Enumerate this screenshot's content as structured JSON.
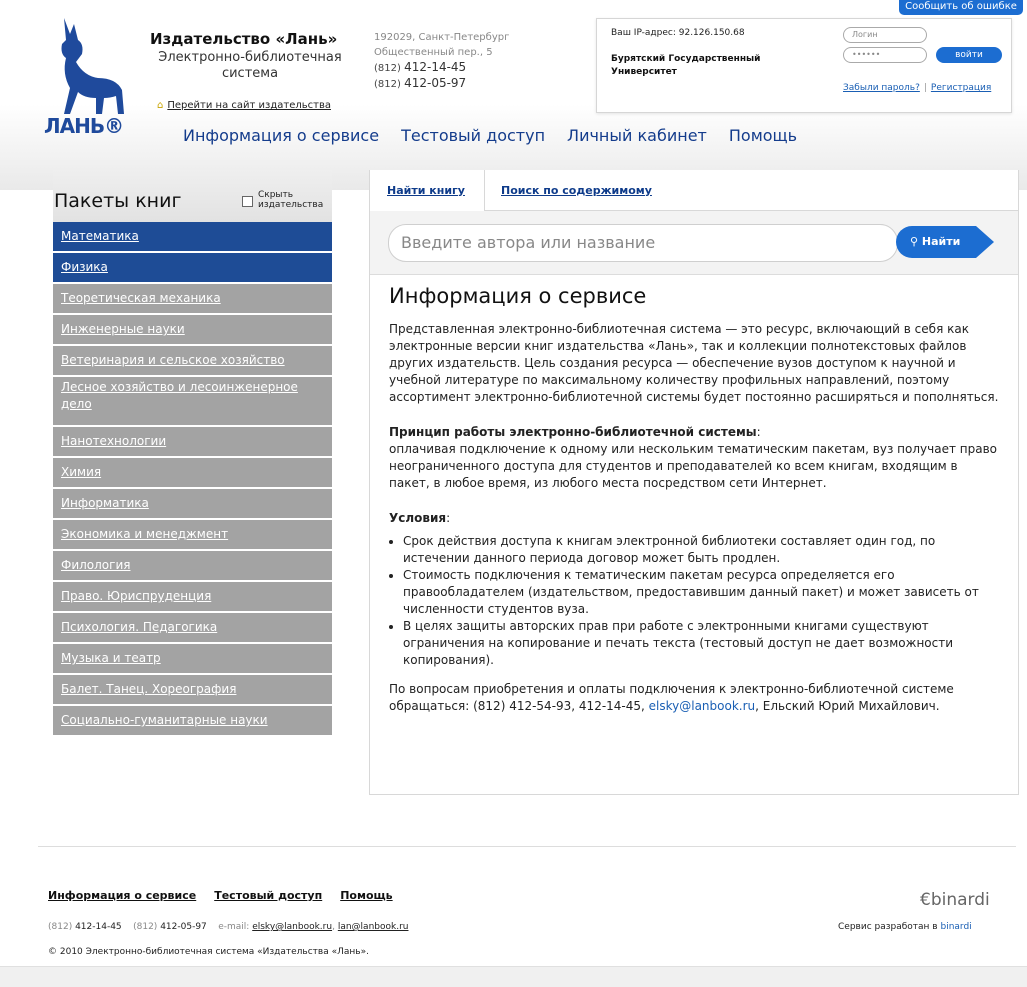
{
  "header": {
    "logo_text": "ЛАНЬ®",
    "brand_title": "Издательство «Лань»",
    "brand_sub": "Электронно-библиотечная система",
    "site_link": "Перейти на сайт издательства",
    "address_line1": "192029, Санкт-Петербург",
    "address_line2": "Общественный пер., 5",
    "phone1_prefix": "(812)",
    "phone1": "412-14-45",
    "phone2_prefix": "(812)",
    "phone2": "412-05-97"
  },
  "login": {
    "report_button": "Сообщить об ошибке",
    "ip_label": "Ваш IP-адрес: 92.126.150.68",
    "organization": "Бурятский Государственный Университет",
    "login_placeholder": "Логин",
    "password_placeholder": "••••••",
    "login_button": "войти",
    "forgot_link": "Забыли пароль?",
    "separator": "|",
    "register_link": "Регистрация"
  },
  "main_nav": [
    "Информация о сервисе",
    "Тестовый доступ",
    "Личный кабинет",
    "Помощь"
  ],
  "sidebar": {
    "title": "Пакеты книг",
    "hide_label": "Скрыть издательства",
    "categories": [
      "Математика",
      "Физика",
      "Теоретическая механика",
      "Инженерные науки",
      "Ветеринария и сельское хозяйство",
      "Лесное хозяйство и лесоинженерное дело",
      "Нанотехнологии",
      "Химия",
      "Информатика",
      "Экономика и менеджмент",
      "Филология",
      "Право. Юриспруденция",
      "Психология. Педагогика",
      "Музыка и театр",
      "Балет. Танец. Хореография",
      "Социально-гуманитарные науки"
    ]
  },
  "tabs": {
    "find_book": "Найти книгу",
    "content_search": "Поиск по содержимому"
  },
  "search": {
    "placeholder": "Введите автора или название",
    "button": "Найти"
  },
  "article": {
    "title": "Информация о сервисе",
    "intro": "Представленная электронно-библиотечная система — это ресурс, включающий в себя как электронные версии книг издательства «Лань», так и коллекции полнотекстовых файлов других издательств. Цель создания ресурса — обеспечение вузов доступом к научной и учебной литературе по максимальному количеству профильных направлений, поэтому ассортимент электронно-библиотечной системы будет постоянно расширяться и пополняться.",
    "principle_heading": "Принцип работы электронно-библиотечной системы",
    "principle_colon": ":",
    "principle_text": "оплачивая подключение к одному или нескольким тематическим пакетам, вуз получает право неограниченного доступа для студентов и преподавателей ко всем книгам, входящим в пакет, в любое время, из любого места посредством сети Интернет.",
    "conditions_heading": "Условия",
    "conditions_colon": ":",
    "conditions": [
      "Срок действия доступа к книгам электронной библиотеки составляет один год, по истечении данного периода договор может быть продлен.",
      "Стоимость подключения к тематическим пакетам ресурса определяется его правообладателем (издательством, предоставившим данный пакет) и может зависеть от численности студентов вуза.",
      "В целях защиты авторских прав при работе с электронными книгами существуют ограничения на копирование и печать текста (тестовый доступ не дает возможности копирования)."
    ],
    "contact_text_before": "По вопросам приобретения и оплаты подключения к электронно-библиотечной системе обращаться: (812) 412-54-93, 412-14-45, ",
    "contact_email": "elsky@lanbook.ru",
    "contact_text_after": ", Ельский Юрий Михайлович."
  },
  "footer": {
    "nav": [
      "Информация о сервисе",
      "Тестовый доступ",
      "Помощь"
    ],
    "phone1_prefix": "(812)",
    "phone1": "412-14-45",
    "phone2_prefix": "(812)",
    "phone2": "412-05-97",
    "email_label": "e-mail:",
    "email1": "elsky@lanbook.ru",
    "email_sep": ",",
    "email2": "lan@lanbook.ru",
    "copyright": "© 2010 Электронно-библиотечная система «Издательства «Лань».",
    "binardi_logo": "binardi",
    "developed_by": "Сервис разработан в",
    "developer": "binardi"
  },
  "colors": {
    "accent_blue": "#1c6dd1",
    "nav_blue": "#143c8c",
    "sidebar_active": "#1e4c96",
    "sidebar_inactive": "#a3a3a3"
  }
}
